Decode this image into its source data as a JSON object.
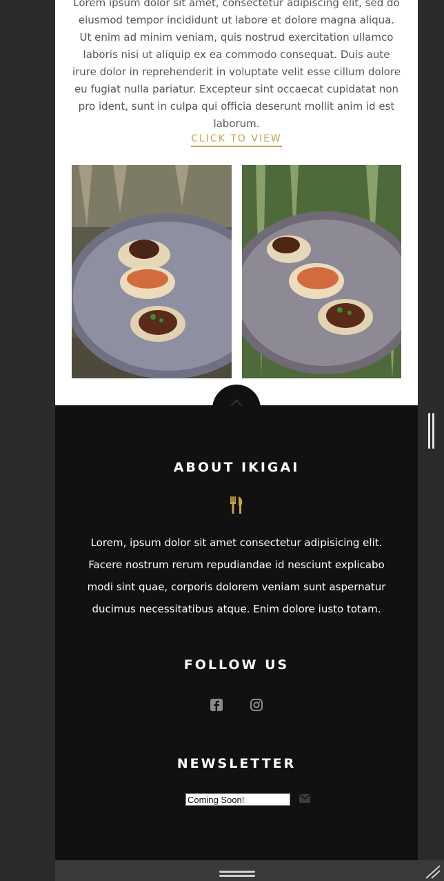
{
  "intro": {
    "text": "Lorem ipsum dolor sit amet, consectetur adipiscing elit, sed do eiusmod tempor incididunt ut labore et dolore magna aliqua. Ut enim ad minim veniam, quis nostrud exercitation ullamco laboris nisi ut aliquip ex ea commodo consequat. Duis aute irure dolor in reprehenderit in voluptate velit esse cillum dolore eu fugiat nulla pariatur. Excepteur sint occaecat cupidatat non pro ident, sunt in culpa qui officia deserunt mollit anim id est laborum."
  },
  "cta": {
    "label": "CLICK TO VIEW"
  },
  "footer": {
    "about_heading": "ABOUT IKIGAI",
    "about_text": "Lorem, ipsum dolor sit amet consectetur adipisicing elit. Facere nostrum rerum repudiandae id nesciunt explicabo modi sint quae, corporis dolorem veniam sunt aspernatur ducimus necessitatibus atque. Enim dolore iusto totam.",
    "follow_heading": "FOLLOW US",
    "newsletter_heading": "NEWSLETTER",
    "newsletter_value": "Coming Soon!"
  },
  "icons": {
    "about": "utensils-icon",
    "social": [
      "facebook-icon",
      "instagram-icon"
    ],
    "newsletter": "envelope-icon"
  },
  "colors": {
    "accent": "#c9a14a",
    "footer_bg": "#111111",
    "page_bg": "#ffffff",
    "outer_bg": "#2b2b2b"
  }
}
